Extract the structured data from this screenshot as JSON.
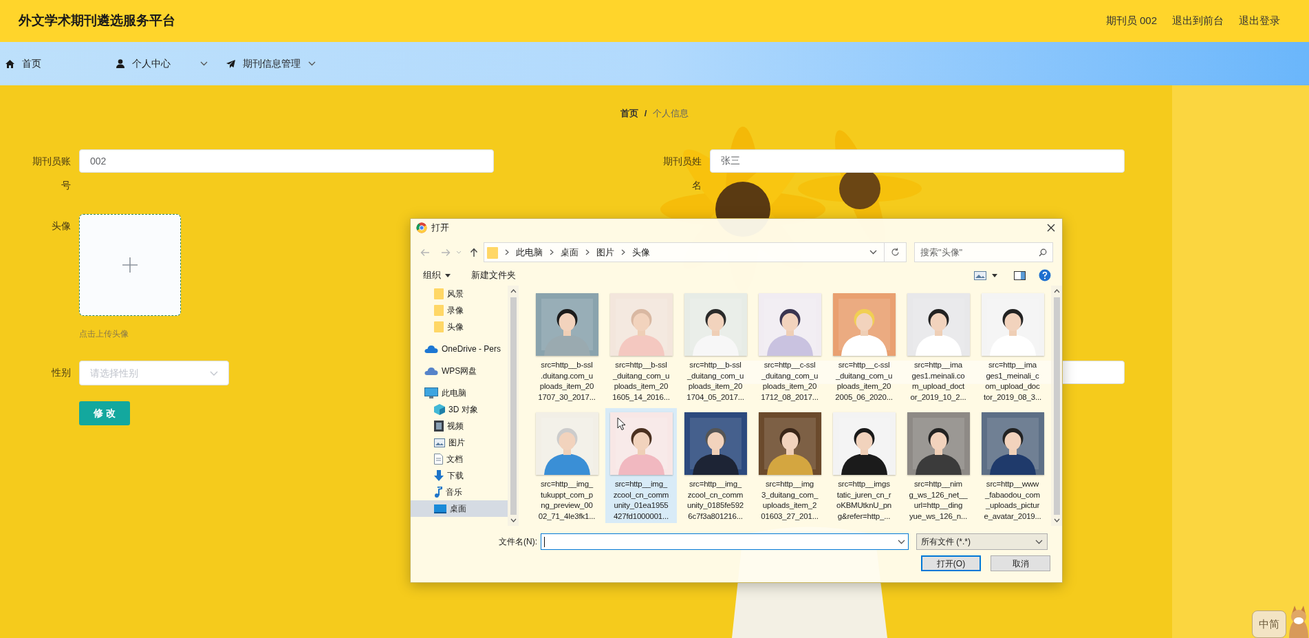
{
  "header": {
    "title": "外文学术期刊遴选服务平台",
    "links": [
      "期刊员 002",
      "退出到前台",
      "退出登录"
    ]
  },
  "nav": [
    {
      "kind": "home",
      "label": "首页",
      "dropdown": false
    },
    {
      "kind": "user",
      "label": "个人中心",
      "dropdown": true
    },
    {
      "kind": "send",
      "label": "期刊信息管理",
      "dropdown": true
    }
  ],
  "breadcrumb": {
    "items": [
      "首页",
      "个人信息"
    ],
    "separator": "/"
  },
  "form": {
    "rows": [
      [
        {
          "kind": "text",
          "label": "期刊员账号",
          "value": "002"
        },
        {
          "kind": "text",
          "label": "期刊员姓名",
          "value": "张三"
        }
      ],
      [
        {
          "kind": "upload",
          "label": "头像",
          "hint": "点击上传头像"
        }
      ],
      [
        {
          "kind": "select",
          "label": "性别",
          "placeholder": "请选择性别"
        },
        {
          "kind": "text"
        }
      ]
    ],
    "submit": "修 改"
  },
  "file_dialog": {
    "title": "打开",
    "path": [
      "此电脑",
      "桌面",
      "图片",
      "头像"
    ],
    "search_placeholder": "搜索\"头像\"",
    "toolbar": [
      "组织",
      "新建文件夹"
    ],
    "sidebar": [
      {
        "kind": "folder",
        "label": "风景",
        "selected": false
      },
      {
        "kind": "folder",
        "label": "录像",
        "selected": false
      },
      {
        "kind": "folder",
        "label": "头像",
        "selected": false
      },
      {
        "kind": "cloud",
        "label": "OneDrive - Pers",
        "selected": false
      },
      {
        "kind": "wps",
        "label": "WPS网盘",
        "selected": false
      },
      {
        "kind": "computer",
        "label": "此电脑",
        "selected": false,
        "children": [
          {
            "kind": "cube",
            "label": "3D 对象",
            "selected": false
          },
          {
            "kind": "video",
            "label": "视频",
            "selected": false
          },
          {
            "kind": "pictures",
            "label": "图片",
            "selected": false
          },
          {
            "kind": "docs",
            "label": "文档",
            "selected": false
          },
          {
            "kind": "download",
            "label": "下载",
            "selected": false
          },
          {
            "kind": "music",
            "label": "音乐",
            "selected": false
          },
          {
            "kind": "desktop",
            "label": "桌面",
            "selected": true
          }
        ]
      }
    ],
    "files": [
      {
        "name": "src=http__b-ssl\n.duitang.com_u\nploads_item_20\n1707_30_2017...",
        "selected": false
      },
      {
        "name": "src=http__b-ssl\n_duitang_com_u\nploads_item_20\n1605_14_2016...",
        "selected": false
      },
      {
        "name": "src=http__b-ssl\n_duitang_com_u\nploads_item_20\n1704_05_2017...",
        "selected": false
      },
      {
        "name": "src=http__c-ssl\n_duitang_com_u\nploads_item_20\n1712_08_2017...",
        "selected": false
      },
      {
        "name": "src=http__c-ssl\n_duitang_com_u\nploads_item_20\n2005_06_2020...",
        "selected": false
      },
      {
        "name": "src=http__ima\nges1.meinali.co\nm_upload_doct\nor_2019_10_2...",
        "selected": false
      },
      {
        "name": "src=http__ima\nges1_meinali_c\nom_upload_doc\ntor_2019_08_3...",
        "selected": false
      },
      {
        "name": "src=http__img_\ntukuppt_com_p\nng_preview_00\n02_71_4Ie3fk1...",
        "selected": false
      },
      {
        "name": "src=http__img_\nzcool_cn_comm\nunity_01ea1955\n427fd1000001...",
        "selected": true
      },
      {
        "name": "src=http__img_\nzcool_cn_comm\nunity_0185fe592\n6c7f3a801216...",
        "selected": false
      },
      {
        "name": "src=http__img\n3_duitang_com_\nuploads_item_2\n01603_27_201...",
        "selected": false
      },
      {
        "name": "src=http__imgs\ntatic_juren_cn_r\noKBMUtknU_pn\ng&refer=http_...",
        "selected": false
      },
      {
        "name": "src=http__nim\ng_ws_126_net__\nurl=http__ding\nyue_ws_126_n...",
        "selected": false
      },
      {
        "name": "src=http__www\n_fabaodou_com\n_uploads_pictur\ne_avatar_2019...",
        "selected": false
      }
    ],
    "filename_label": "文件名(N):",
    "filter": "所有文件 (*.*)",
    "buttons": [
      "打开(O)",
      "取消"
    ]
  },
  "ime": {
    "label": "中简"
  }
}
